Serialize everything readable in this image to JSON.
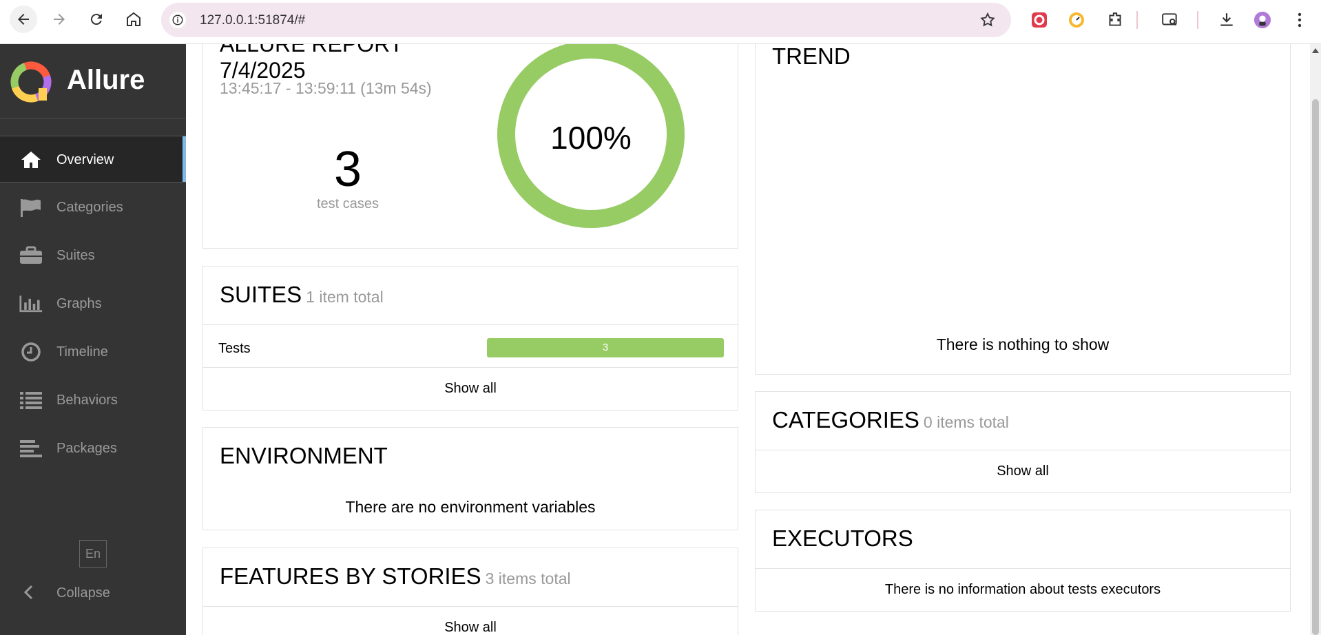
{
  "browser": {
    "url": "127.0.0.1:51874/#",
    "back_icon": "arrow-left",
    "forward_icon": "arrow-right",
    "reload_icon": "reload",
    "home_icon": "home"
  },
  "sidebar": {
    "brand": "Allure",
    "items": [
      {
        "label": "Overview",
        "icon": "home-icon",
        "active": true
      },
      {
        "label": "Categories",
        "icon": "flag-icon"
      },
      {
        "label": "Suites",
        "icon": "briefcase-icon"
      },
      {
        "label": "Graphs",
        "icon": "bar-chart-icon"
      },
      {
        "label": "Timeline",
        "icon": "clock-icon"
      },
      {
        "label": "Behaviors",
        "icon": "list-icon"
      },
      {
        "label": "Packages",
        "icon": "align-left-icon"
      }
    ],
    "language": "En",
    "collapse_label": "Collapse"
  },
  "summary": {
    "title_line1": "ALLURE REPORT",
    "title_line2": "7/4/2025",
    "time_range": "13:45:17 - 13:59:11 (13m 54s)",
    "test_count": "3",
    "test_count_label": "test cases",
    "pass_rate": "100%",
    "pass_fraction": 1.0,
    "pass_color": "#97cc64"
  },
  "suites": {
    "title": "SUITES",
    "subtitle": "1 item total",
    "rows": [
      {
        "name": "Tests",
        "value": "3",
        "passed_fraction": 1.0
      }
    ],
    "show_all": "Show all"
  },
  "environment": {
    "title": "ENVIRONMENT",
    "empty": "There are no environment variables"
  },
  "features": {
    "title": "FEATURES BY STORIES",
    "subtitle": "3 items total",
    "show_all": "Show all"
  },
  "trend": {
    "title": "TREND",
    "empty": "There is nothing to show"
  },
  "categories": {
    "title": "CATEGORIES",
    "subtitle": "0 items total",
    "show_all": "Show all"
  },
  "executors": {
    "title": "EXECUTORS",
    "empty": "There is no information about tests executors"
  }
}
